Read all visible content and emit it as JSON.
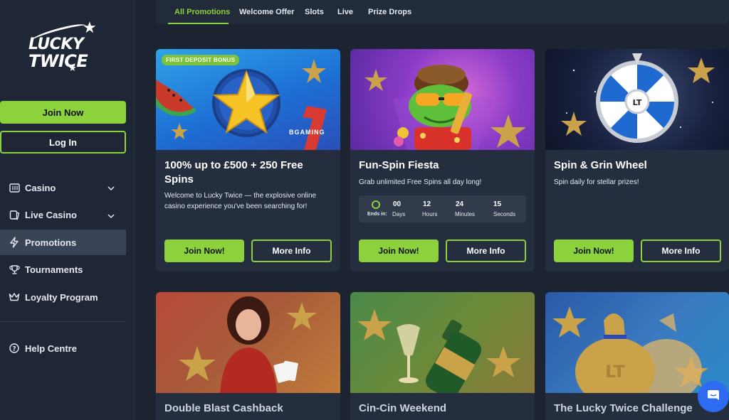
{
  "brand": {
    "line1": "LUCKY",
    "line2": "TWICE"
  },
  "sidebar": {
    "join_label": "Join Now",
    "login_label": "Log In",
    "items": [
      {
        "label": "Casino",
        "icon": "slot-machine-icon",
        "expandable": true,
        "active": false
      },
      {
        "label": "Live Casino",
        "icon": "cards-icon",
        "expandable": true,
        "active": false
      },
      {
        "label": "Promotions",
        "icon": "lightning-icon",
        "expandable": false,
        "active": true
      },
      {
        "label": "Tournaments",
        "icon": "trophy-icon",
        "expandable": false,
        "active": false
      },
      {
        "label": "Loyalty Program",
        "icon": "crown-icon",
        "expandable": false,
        "active": false
      }
    ],
    "help_label": "Help Centre"
  },
  "tabs": [
    {
      "label": "All Promotions",
      "active": true
    },
    {
      "label": "Welcome Offer",
      "active": false
    },
    {
      "label": "Slots",
      "active": false
    },
    {
      "label": "Live",
      "active": false
    },
    {
      "label": "Prize Drops",
      "active": false
    }
  ],
  "cards": [
    {
      "badge": "FIRST DEPOSIT BONUS",
      "title_line1": "100% up to £500 + 250 Free",
      "title_line2": "Spins",
      "desc_line1": "Welcome to Lucky Twice — the explosive online",
      "desc_line2": "casino experience you've been searching for!",
      "join": "Join Now!",
      "info": "More Info",
      "provider": "BGAMING"
    },
    {
      "title": "Fun-Spin Fiesta",
      "desc": "Grab unlimited Free Spins all day long!",
      "join": "Join Now!",
      "info": "More Info",
      "timer": {
        "label": "Ends in:",
        "days": "00",
        "days_unit": "Days",
        "hours": "12",
        "hours_unit": "Hours",
        "minutes": "24",
        "minutes_unit": "Minutes",
        "seconds": "15",
        "seconds_unit": "Seconds"
      }
    },
    {
      "title": "Spin & Grin Wheel",
      "desc": "Spin daily for stellar prizes!",
      "join": "Join Now!",
      "info": "More Info",
      "wheel_logo": "LT"
    },
    {
      "title": "Double Blast Cashback"
    },
    {
      "title": "Cin-Cin Weekend"
    },
    {
      "title": "The Lucky Twice Challenge"
    }
  ],
  "colors": {
    "accent": "#8bd23c",
    "bg": "#1c2331",
    "card": "#252e3e",
    "chat": "#2d6cf0"
  }
}
